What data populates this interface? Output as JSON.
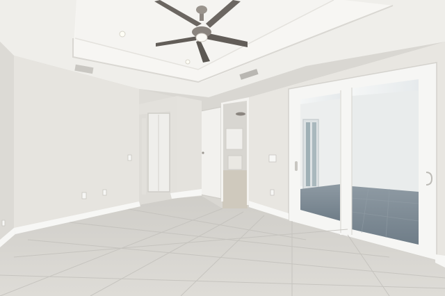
{
  "photo": {
    "subject": "empty-bedroom-interior",
    "colors": {
      "ceiling": "#f3f2ef",
      "tray": "#f7f6f3",
      "wall": "#e6e4df",
      "wall_shadow": "#d8d6d1",
      "floor": "#d6d4cf",
      "baseboard": "#f6f6f4",
      "door": "#f2f1ee",
      "glass": "#eef1f2",
      "patio": "#7e8b95",
      "fan_metal": "#6b6661"
    }
  }
}
